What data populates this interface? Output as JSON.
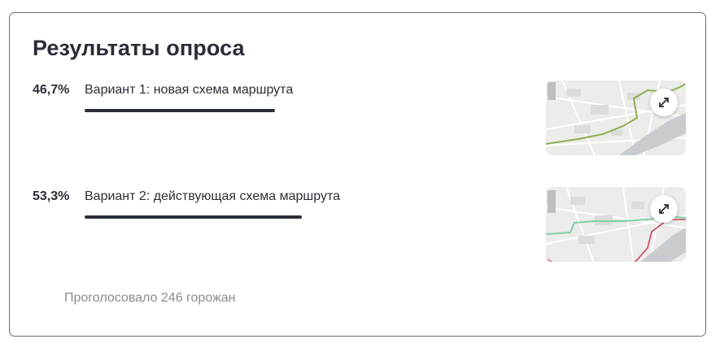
{
  "poll": {
    "title": "Результаты опроса",
    "options": [
      {
        "percent_label": "46,7%",
        "percent": 46.7,
        "label": "Вариант 1: новая схема маршрута",
        "route_color": "#8fae52",
        "thumb_icon": "expand-icon"
      },
      {
        "percent_label": "53,3%",
        "percent": 53.3,
        "label": "Вариант 2: действующая схема маршрута",
        "route_color": "#c9455a",
        "thumb_icon": "expand-icon"
      }
    ],
    "total_votes": "Проголосовало 246 горожан"
  },
  "colors": {
    "text": "#2b2e38",
    "bar": "#2b2e38",
    "muted": "#8a8c93",
    "border": "#6f6f74"
  }
}
